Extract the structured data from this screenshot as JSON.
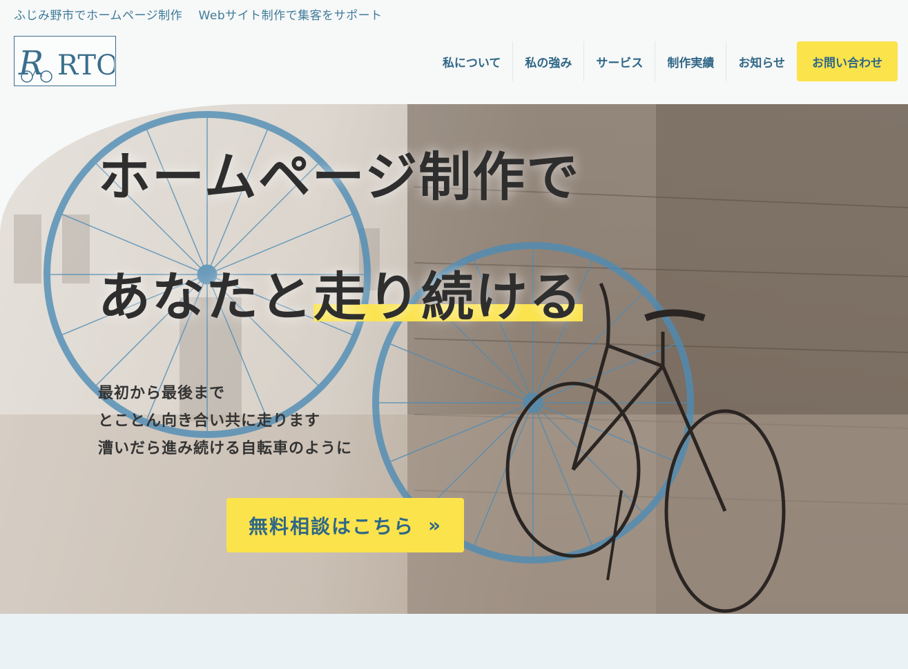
{
  "header": {
    "tagline": "ふじみ野市でホームページ制作　 Webサイト制作で集客をサポート",
    "logo_text": "RTO"
  },
  "nav": {
    "items": [
      "私について",
      "私の強み",
      "サービス",
      "制作実績",
      "お知らせ"
    ],
    "contact": "お問い合わせ"
  },
  "hero": {
    "title_line1": "ホームページ制作で",
    "title_line2_plain": "あなたと",
    "title_line2_highlight": "走り続ける",
    "copy": [
      "最初から最後まで",
      "とことん向き合い共に走ります",
      "漕いだら進み続ける自転車のように"
    ],
    "cta_label": "無料相談はこちら",
    "cta_icon": "double-chevron-right-icon"
  },
  "colors": {
    "accent_yellow": "#fbe34c",
    "brand_blue": "#2f6786",
    "wheel_blue": "#4e8cb5"
  }
}
